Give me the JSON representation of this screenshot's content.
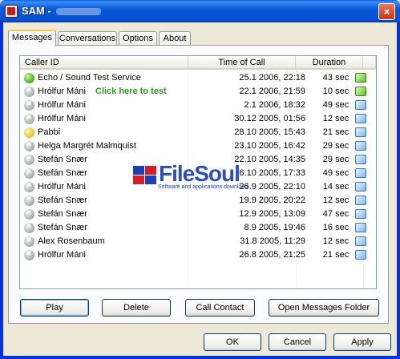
{
  "window": {
    "title": "SAM -",
    "close_glyph": "×"
  },
  "tabs": [
    {
      "label": "Messages",
      "active": true
    },
    {
      "label": "Conversations",
      "active": false
    },
    {
      "label": "Options",
      "active": false
    },
    {
      "label": "About",
      "active": false
    }
  ],
  "messages": {
    "columns": {
      "caller_id": "Caller ID",
      "time_of_call": "Time of Call",
      "duration": "Duration"
    },
    "rows": [
      {
        "caller_id": "Echo / Sound Test Service",
        "time": "25.1 2006, 22:18",
        "duration": "43 sec",
        "status_icon": "green-contact-icon",
        "message_icon": "new-message-icon"
      },
      {
        "caller_id": "Hrólfur Máni",
        "time": "22.1 2006, 21:59",
        "duration": "10 sec",
        "status_icon": "offline-contact-icon",
        "message_icon": "new-message-icon"
      },
      {
        "caller_id": "Hrólfur Máni",
        "time": "2.1 2006, 18:32",
        "duration": "49 sec",
        "status_icon": "offline-contact-icon",
        "message_icon": "message-icon"
      },
      {
        "caller_id": "Hrólfur Máni",
        "time": "30.12 2005, 01:56",
        "duration": "12 sec",
        "status_icon": "offline-contact-icon",
        "message_icon": "message-icon"
      },
      {
        "caller_id": "Pabbi",
        "time": "28.10 2005, 15:43",
        "duration": "21 sec",
        "status_icon": "away-contact-icon",
        "message_icon": "message-icon"
      },
      {
        "caller_id": "Helga Margrét Malmquist",
        "time": "23.10 2005, 16:42",
        "duration": "29 sec",
        "status_icon": "offline-contact-icon",
        "message_icon": "message-icon"
      },
      {
        "caller_id": "Stefán Snær",
        "time": "22.10 2005, 14:35",
        "duration": "29 sec",
        "status_icon": "offline-contact-icon",
        "message_icon": "message-icon"
      },
      {
        "caller_id": "Stefán Snær",
        "time": "6.10 2005, 17:33",
        "duration": "49 sec",
        "status_icon": "offline-contact-icon",
        "message_icon": "message-icon"
      },
      {
        "caller_id": "Hrólfur Máni",
        "time": "26.9 2005, 22:10",
        "duration": "14 sec",
        "status_icon": "offline-contact-icon",
        "message_icon": "message-icon"
      },
      {
        "caller_id": "Stefán Snær",
        "time": "19.9 2005, 20:22",
        "duration": "12 sec",
        "status_icon": "offline-contact-icon",
        "message_icon": "message-icon"
      },
      {
        "caller_id": "Stefán Snær",
        "time": "12.9 2005, 13:09",
        "duration": "47 sec",
        "status_icon": "offline-contact-icon",
        "message_icon": "message-icon"
      },
      {
        "caller_id": "Stefán Snær",
        "time": "8.9 2005, 19:46",
        "duration": "16 sec",
        "status_icon": "offline-contact-icon",
        "message_icon": "message-icon"
      },
      {
        "caller_id": "Alex Rosenbaum",
        "time": "31.8 2005, 11:29",
        "duration": "12 sec",
        "status_icon": "offline-contact-icon",
        "message_icon": "message-icon"
      },
      {
        "caller_id": "Hrólfur Máni",
        "time": "26.8 2005, 21:25",
        "duration": "21 sec",
        "status_icon": "offline-contact-icon",
        "message_icon": "message-icon"
      }
    ],
    "click_hint": "Click here to test",
    "buttons": {
      "play": "Play",
      "delete": "Delete",
      "call_contact": "Call Contact",
      "open_folder": "Open Messages Folder"
    }
  },
  "watermark": {
    "title": "FileSoul",
    "subtitle": "Software and applications download"
  },
  "dialog_buttons": {
    "ok": "OK",
    "cancel": "Cancel",
    "apply": "Apply"
  }
}
